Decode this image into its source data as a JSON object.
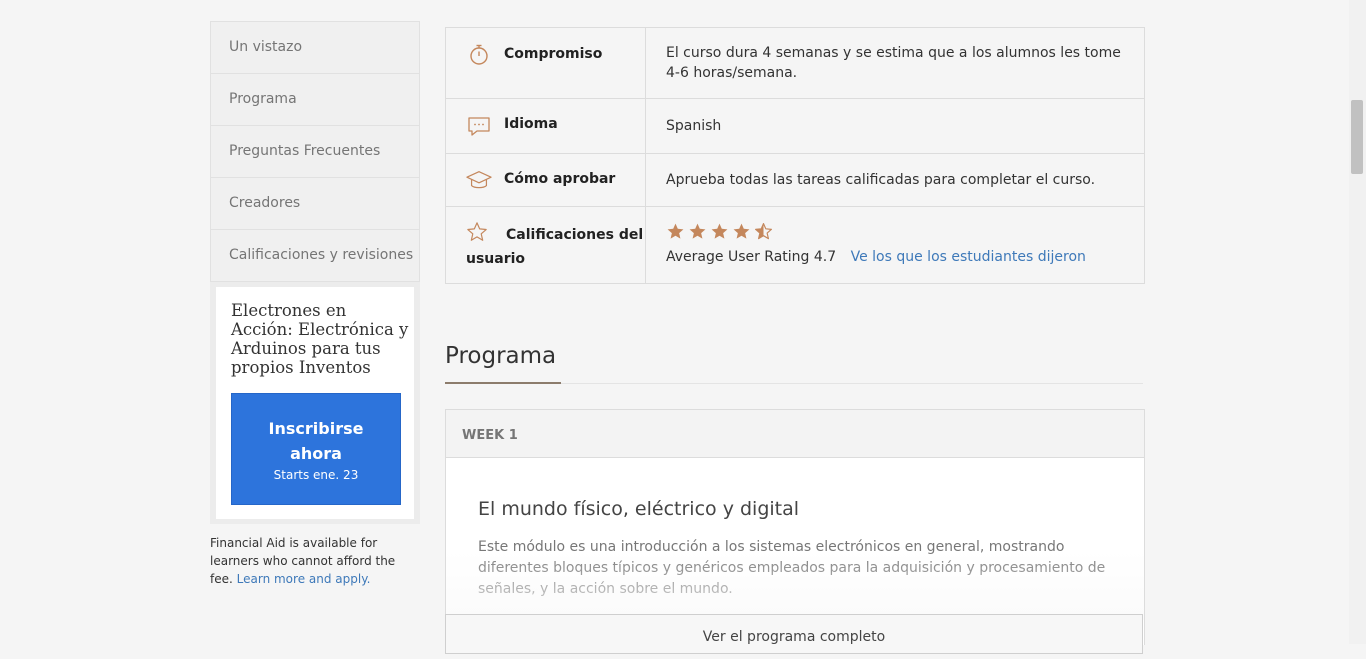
{
  "nav": {
    "items": [
      {
        "label": "Un vistazo"
      },
      {
        "label": "Programa"
      },
      {
        "label": "Preguntas Frecuentes"
      },
      {
        "label": "Creadores"
      },
      {
        "label": "Calificaciones y revisiones"
      }
    ]
  },
  "enroll": {
    "course_title": "Electrones en Acción: Electrónica y Arduinos para tus propios Inventos",
    "button_label": "Inscribirse ahora",
    "start": "Starts ene. 23"
  },
  "aid": {
    "text": "Financial Aid is available for learners who cannot afford the fee.",
    "link": "Learn more and apply."
  },
  "info": {
    "commitment": {
      "label": "Compromiso",
      "value": "El curso dura 4 semanas y se estima que a los alumnos les tome 4-6 horas/semana.",
      "icon": "stopwatch-icon"
    },
    "language": {
      "label": "Idioma",
      "value": "Spanish",
      "icon": "chat-bubble-icon"
    },
    "pass": {
      "label": "Cómo aprobar",
      "value": "Aprueba todas las tareas calificadas para completar el curso.",
      "icon": "graduation-cap-icon"
    },
    "ratings": {
      "label": "Calificaciones del usuario",
      "icon": "star-outline-icon",
      "rating": 4.7,
      "stars_full": 4,
      "stars_half": 1,
      "average_text": "Average User Rating 4.7",
      "link": "Ve los que los estudiantes dijeron"
    }
  },
  "syllabus": {
    "title": "Programa",
    "week_label": "WEEK 1",
    "module_title": "El mundo físico, eléctrico y digital",
    "module_desc": "Este módulo es una introducción a los sistemas electrónicos en general, mostrando diferentes bloques típicos y genéricos empleados para la adquisición y procesamiento de señales, y la acción sobre el mundo.",
    "full_button": "Ver el programa completo"
  },
  "colors": {
    "accent": "#2d74dc",
    "link": "#3e79b9",
    "star": "#c4875c"
  }
}
